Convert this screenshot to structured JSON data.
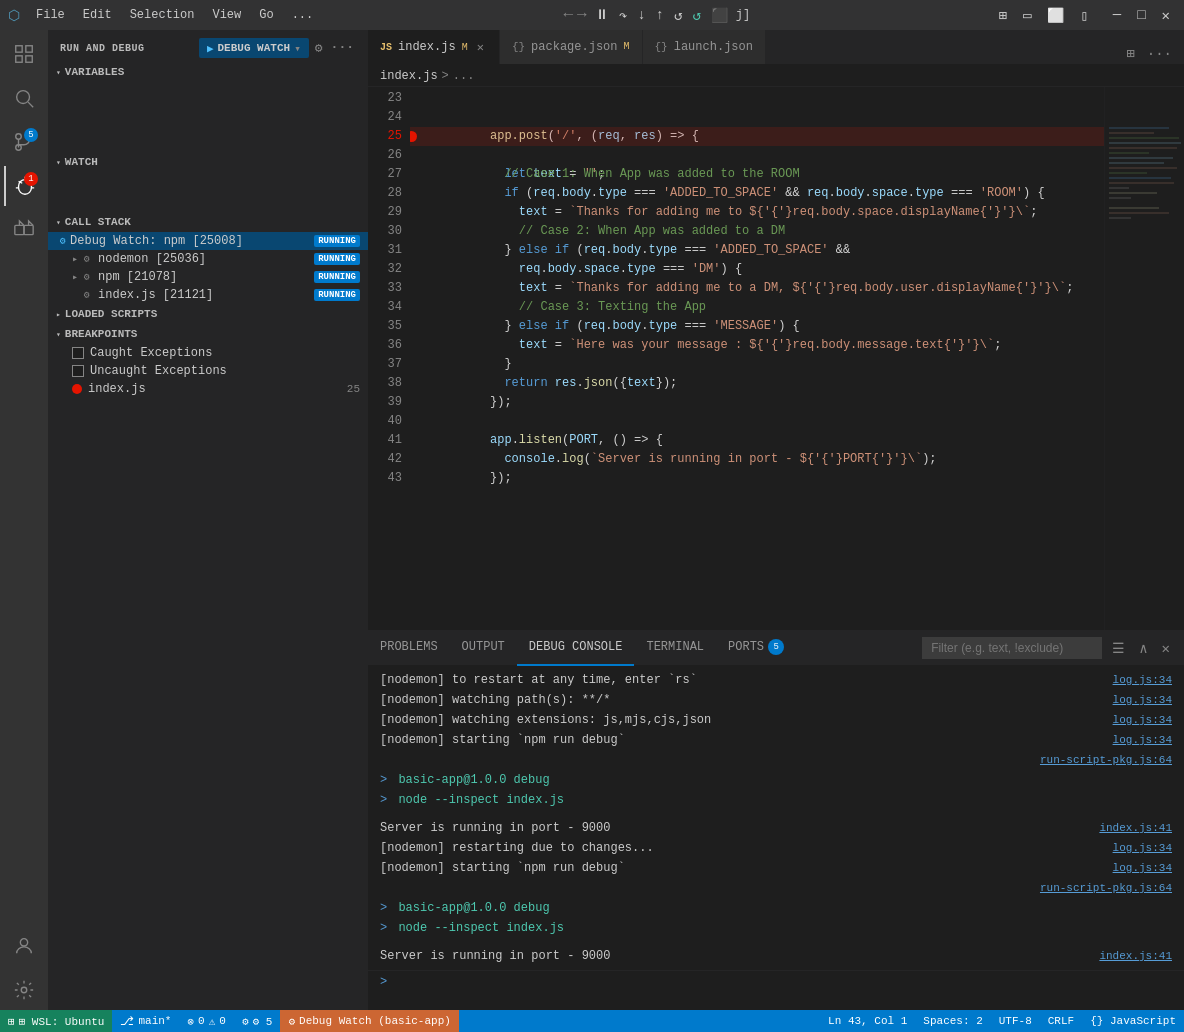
{
  "titlebar": {
    "icon": "⬡",
    "menus": [
      "File",
      "Edit",
      "Selection",
      "View",
      "Go",
      "..."
    ],
    "nav_back": "←",
    "nav_forward": "→",
    "debug_controls": [
      "⏸",
      "▶",
      "⬇",
      "⬆",
      "⏩",
      "🔄",
      "⬛",
      "🔴"
    ],
    "title": "j]",
    "window_controls": [
      "🗖",
      "⧉",
      "🗗",
      "✕"
    ]
  },
  "sidebar": {
    "header": "RUN AND DEBUG",
    "config_icon": "⚙",
    "more_icon": "...",
    "debug_select": "Debug Watch",
    "variables_section": "VARIABLES",
    "watch_section": "WATCH",
    "callstack_section": "CALL STACK",
    "callstack_items": [
      {
        "icon": "⚙",
        "name": "Debug Watch: npm [25008]",
        "status": "RUNNING",
        "indent": 0
      },
      {
        "icon": "⚙",
        "name": "nodemon [25036]",
        "status": "RUNNING",
        "indent": 1
      },
      {
        "icon": "⚙",
        "name": "npm [21078]",
        "status": "RUNNING",
        "indent": 1
      },
      {
        "icon": "⚙",
        "name": "index.js [21121]",
        "status": "RUNNING",
        "indent": 2
      }
    ],
    "loaded_scripts": "LOADED SCRIPTS",
    "breakpoints_section": "BREAKPOINTS",
    "breakpoints": [
      {
        "type": "checkbox",
        "checked": false,
        "label": "Caught Exceptions"
      },
      {
        "type": "checkbox",
        "checked": false,
        "label": "Uncaught Exceptions"
      },
      {
        "type": "dot",
        "label": "index.js",
        "detail": "25"
      }
    ]
  },
  "tabs": [
    {
      "icon": "JS",
      "label": "index.js",
      "modified": true,
      "active": true,
      "close": true
    },
    {
      "icon": "{}",
      "label": "package.json",
      "modified": true,
      "active": false,
      "close": false
    },
    {
      "icon": "{}",
      "label": "launch.json",
      "modified": false,
      "active": false,
      "close": false
    }
  ],
  "breadcrumb": {
    "file": "index.js",
    "sep": ">",
    "path": "..."
  },
  "code": {
    "lines": [
      {
        "num": 23,
        "content": ""
      },
      {
        "num": 24,
        "content": "app.post('/', (req, res) => {",
        "parts": [
          {
            "t": "fn",
            "v": "app.post"
          },
          {
            "t": "op",
            "v": "("
          },
          {
            "t": "str",
            "v": "'/'"
          },
          {
            "t": "op",
            "v": ", ("
          },
          {
            "t": "var",
            "v": "req"
          },
          {
            "t": "op",
            "v": ", "
          },
          {
            "t": "var",
            "v": "res"
          },
          {
            "t": "op",
            "v": ") => {"
          }
        ]
      },
      {
        "num": 25,
        "content": "  let text = '';",
        "breakpoint": true
      },
      {
        "num": 26,
        "content": "  // Case 1: When App was added to the ROOM",
        "type": "comment"
      },
      {
        "num": 27,
        "content": "  if (req.body.type === 'ADDED_TO_SPACE' && req.body.space.type === 'ROOM') {"
      },
      {
        "num": 28,
        "content": "    text = `Thanks for adding me to ${req.body.space.displayName}`;"
      },
      {
        "num": 29,
        "content": "    // Case 2: When App was added to a DM",
        "type": "comment"
      },
      {
        "num": 30,
        "content": "  } else if (req.body.type === 'ADDED_TO_SPACE' &&"
      },
      {
        "num": 31,
        "content": "    req.body.space.type === 'DM') {"
      },
      {
        "num": 32,
        "content": "    text = `Thanks for adding me to a DM, ${req.body.user.displayName}`;"
      },
      {
        "num": 33,
        "content": "    // Case 3: Texting the App",
        "type": "comment"
      },
      {
        "num": 34,
        "content": "  } else if (req.body.type === 'MESSAGE') {"
      },
      {
        "num": 35,
        "content": "    text = `Here was your message : ${req.body.message.text}`;"
      },
      {
        "num": 36,
        "content": "  }"
      },
      {
        "num": 37,
        "content": "  return res.json({text});"
      },
      {
        "num": 38,
        "content": "});"
      },
      {
        "num": 39,
        "content": ""
      },
      {
        "num": 40,
        "content": "app.listen(PORT, () => {"
      },
      {
        "num": 41,
        "content": "  console.log(`Server is running in port - ${PORT}`);"
      },
      {
        "num": 42,
        "content": "});"
      },
      {
        "num": 43,
        "content": ""
      }
    ]
  },
  "panel": {
    "tabs": [
      {
        "label": "PROBLEMS",
        "active": false
      },
      {
        "label": "OUTPUT",
        "active": false
      },
      {
        "label": "DEBUG CONSOLE",
        "active": true
      },
      {
        "label": "TERMINAL",
        "active": false
      },
      {
        "label": "PORTS",
        "active": false,
        "badge": "5"
      }
    ],
    "filter_placeholder": "Filter (e.g. text, !exclude)",
    "console_lines": [
      {
        "text": "[nodemon] to restart at any time, enter `rs`",
        "link": "log.js:34"
      },
      {
        "text": "[nodemon] watching path(s): **/*",
        "link": "log.js:34"
      },
      {
        "text": "[nodemon] watching extensions: js,mjs,cjs,json",
        "link": "log.js:34"
      },
      {
        "text": "[nodemon] starting `npm run debug`",
        "link": "log.js:34"
      },
      {
        "text": "",
        "link": "run-script-pkg.js:64"
      },
      {
        "text": "> basic-app@1.0.0 debug",
        "link": "",
        "prompt": true
      },
      {
        "text": "> node --inspect index.js",
        "link": "",
        "prompt": true
      },
      {
        "text": "",
        "link": ""
      },
      {
        "text": "Server is running in port - 9000",
        "link": "index.js:41",
        "green": true
      },
      {
        "text": "[nodemon] restarting due to changes...",
        "link": "log.js:34"
      },
      {
        "text": "[nodemon] starting `npm run debug`",
        "link": "log.js:34"
      },
      {
        "text": "",
        "link": "run-script-pkg.js:64"
      },
      {
        "text": "> basic-app@1.0.0 debug",
        "link": "",
        "prompt": true
      },
      {
        "text": "> node --inspect index.js",
        "link": "",
        "prompt": true
      },
      {
        "text": "",
        "link": ""
      },
      {
        "text": "Server is running in port - 9000",
        "link": "index.js:41",
        "green": true
      }
    ]
  },
  "statusbar": {
    "wsl": "⊞ WSL: Ubuntu",
    "git": " main*",
    "errors": "⊗ 0",
    "warnings": "⚠ 0",
    "debug": "⚙ 5",
    "debug_session": "Debug Watch (basic-app)",
    "position": "Ln 43, Col 1",
    "spaces": "Spaces: 2",
    "encoding": "UTF-8",
    "line_ending": "CRLF",
    "language": "{} JavaScript"
  }
}
